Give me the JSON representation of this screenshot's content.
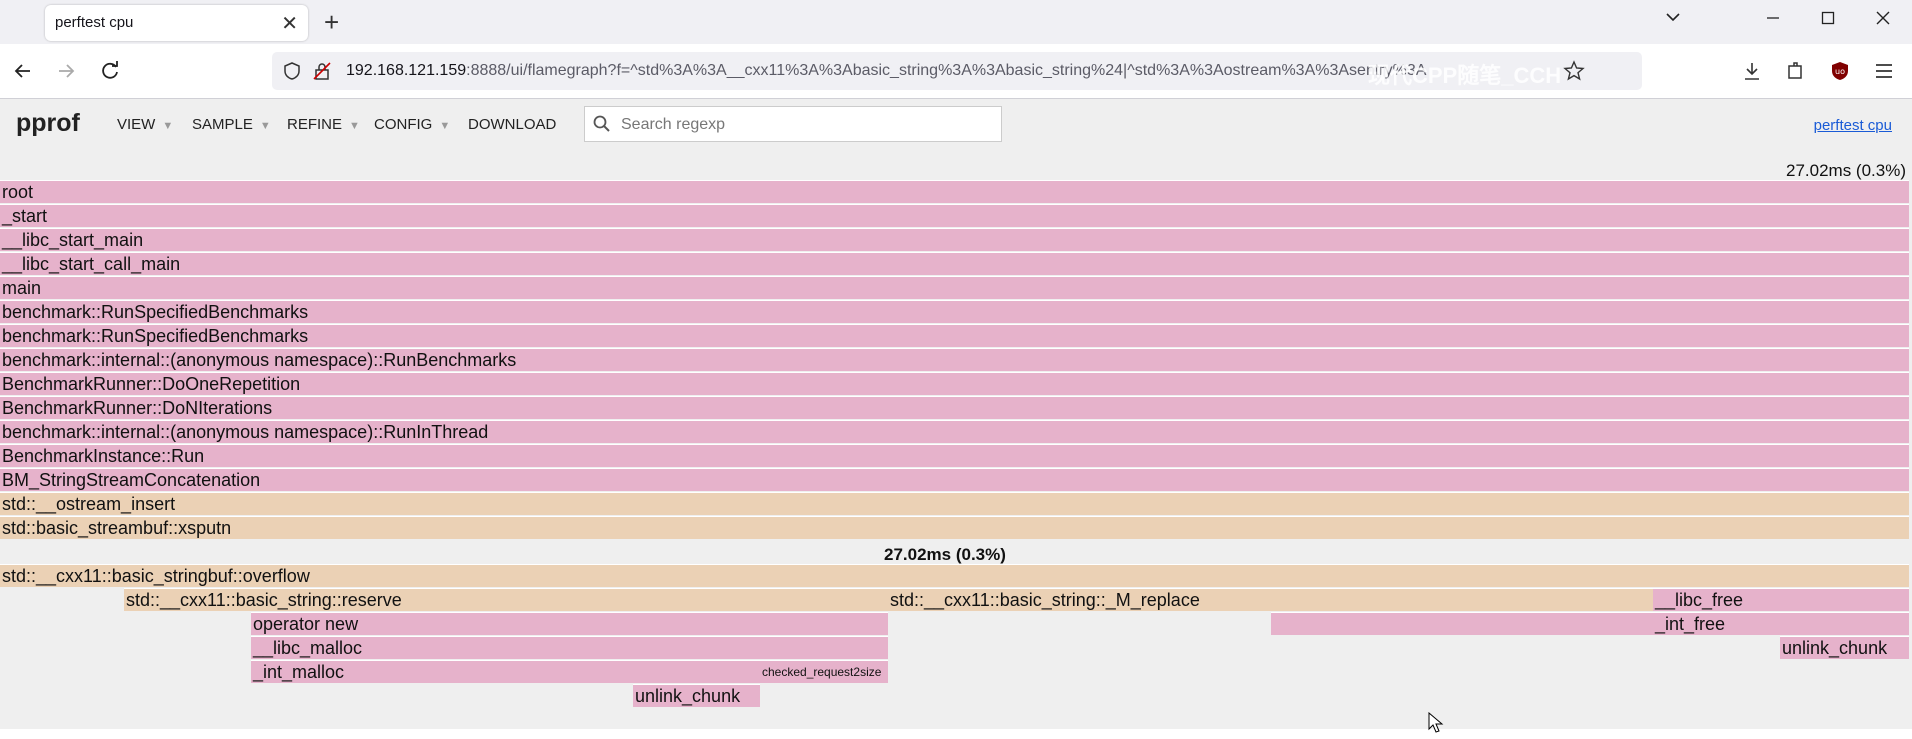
{
  "browser": {
    "tab_title": "perftest cpu",
    "url_host": "192.168.121.159",
    "url_rest": ":8888/ui/flamegraph?f=^std%3A%3A__cxx11%3A%3Abasic_string%3A%3Abasic_string%24|^std%3A%3Aostream%3A%3Asentry%3A",
    "watermark": "现代CPP随笔_CCH"
  },
  "pprof": {
    "logo": "pprof",
    "menus": [
      "VIEW",
      "SAMPLE",
      "REFINE",
      "CONFIG",
      "DOWNLOAD"
    ],
    "search_placeholder": "Search regexp",
    "page_link": "perftest cpu"
  },
  "flamegraph": {
    "top_detail": "27.02ms (0.3%)",
    "focus_detail": "27.02ms (0.3%)",
    "ancestor_frames": [
      {
        "label": "root",
        "color": "pink"
      },
      {
        "label": "_start",
        "color": "pink"
      },
      {
        "label": "__libc_start_main",
        "color": "pink"
      },
      {
        "label": "__libc_start_call_main",
        "color": "pink"
      },
      {
        "label": "main",
        "color": "pink"
      },
      {
        "label": "benchmark::RunSpecifiedBenchmarks",
        "color": "pink"
      },
      {
        "label": "benchmark::RunSpecifiedBenchmarks",
        "color": "pink"
      },
      {
        "label": "benchmark::internal::(anonymous namespace)::RunBenchmarks",
        "color": "pink"
      },
      {
        "label": "BenchmarkRunner::DoOneRepetition",
        "color": "pink"
      },
      {
        "label": "BenchmarkRunner::DoNIterations",
        "color": "pink"
      },
      {
        "label": "benchmark::internal::(anonymous namespace)::RunInThread",
        "color": "pink"
      },
      {
        "label": "BenchmarkInstance::Run",
        "color": "pink"
      },
      {
        "label": "BM_StringStreamConcatenation",
        "color": "pink"
      },
      {
        "label": "std::__ostream_insert",
        "color": "tan"
      },
      {
        "label": "std::basic_streambuf::xsputn",
        "color": "tan"
      }
    ],
    "focus_frames": [
      {
        "label": "std::__cxx11::basic_stringbuf::overflow",
        "color": "tan"
      },
      {
        "label": "std::__cxx11::basic_string::reserve",
        "color": "tan"
      },
      {
        "label": "std::__cxx11::basic_string::_M_replace",
        "color": "tan"
      },
      {
        "label": "__libc_free",
        "color": "pink"
      },
      {
        "label": "operator new",
        "color": "pink"
      },
      {
        "label": "",
        "color": "pink"
      },
      {
        "label": "_int_free",
        "color": "pink"
      },
      {
        "label": "__libc_malloc",
        "color": "pink"
      },
      {
        "label": "unlink_chunk",
        "color": "pink"
      },
      {
        "label": "_int_malloc",
        "color": "pink"
      },
      {
        "label": "checked_request2size",
        "color": "pink"
      },
      {
        "label": "unlink_chunk",
        "color": "pink"
      }
    ]
  }
}
